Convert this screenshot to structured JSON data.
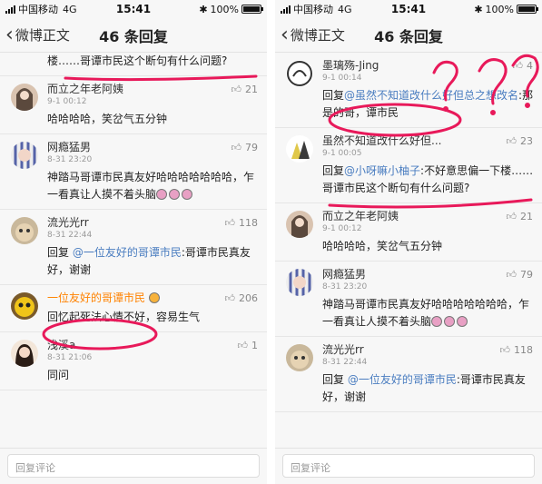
{
  "status": {
    "carrier": "中国移动",
    "network": "4G",
    "time": "15:41",
    "battery": "100%"
  },
  "nav": {
    "back_label": "微博正文",
    "title": "46 条回复"
  },
  "reply_placeholder": "回复评论",
  "left": {
    "truncated": {
      "prefix": "楼……",
      "text": "哥谭市民这个断句有什么问题?"
    },
    "comments": [
      {
        "name": "而立之年老阿姨",
        "time": "9-1 00:12",
        "likes": "21",
        "text": "哈哈哈哈，笑岔气五分钟"
      },
      {
        "name": "网瘾猛男",
        "time": "8-31 23:20",
        "likes": "79",
        "text": "神踏马哥谭市民真友好哈哈哈哈哈哈哈，乍一看真让人摸不着头脑"
      },
      {
        "name": "流光光rr",
        "time": "8-31 22:44",
        "likes": "118",
        "reply_prefix": "回复 ",
        "mention": "@一位友好的哥谭市民",
        "text": ":哥谭市民真友好，谢谢"
      },
      {
        "name": "一位友好的哥谭市民",
        "time": "",
        "likes": "206",
        "text": "回忆起死法心情不好，容易生气"
      },
      {
        "name": "浅溪a",
        "time": "8-31 21:06",
        "likes": "1",
        "text": "同问"
      }
    ]
  },
  "right": {
    "comments": [
      {
        "name": "墨璃殇-Jing",
        "time": "9-1 00:14",
        "likes": "4",
        "reply_prefix": "回复",
        "mention": "@虽然不知道改什么好但总之想改名",
        "text": ":那是的哥，谭市民"
      },
      {
        "name": "虽然不知道改什么好但...",
        "time": "9-1 00:05",
        "likes": "23",
        "reply_prefix": "回复",
        "mention": "@小呀嘛小柚子",
        "text": ":不好意思偏一下楼……哥谭市民这个断句有什么问题?"
      },
      {
        "name": "而立之年老阿姨",
        "time": "9-1 00:12",
        "likes": "21",
        "text": "哈哈哈哈，笑岔气五分钟"
      },
      {
        "name": "网瘾猛男",
        "time": "8-31 23:20",
        "likes": "79",
        "text": "神踏马哥谭市民真友好哈哈哈哈哈哈哈，乍一看真让人摸不着头脑"
      },
      {
        "name": "流光光rr",
        "time": "8-31 22:44",
        "likes": "118",
        "reply_prefix": "回复 ",
        "mention": "@一位友好的哥谭市民",
        "text": ":哥谭市民真友好，谢谢"
      }
    ]
  },
  "colors": {
    "link": "#4a7dc0",
    "annotation": "#e8195a",
    "highlight_name": "#ff8200"
  }
}
